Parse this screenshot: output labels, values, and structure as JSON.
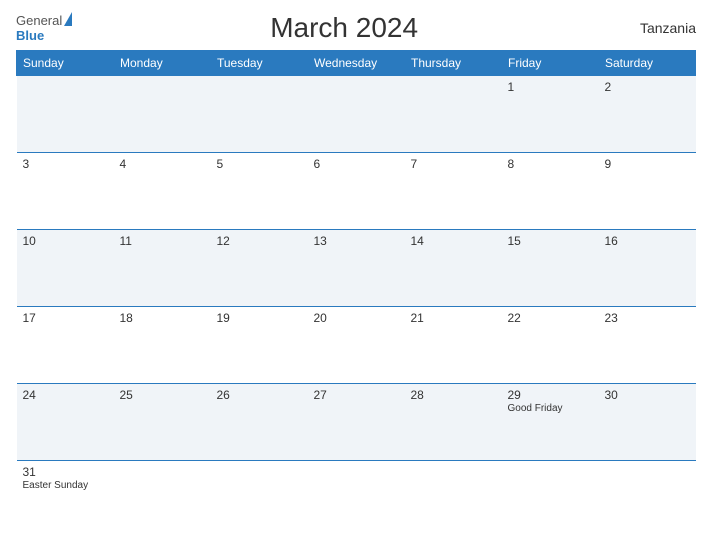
{
  "header": {
    "title": "March 2024",
    "country": "Tanzania",
    "logo_general": "General",
    "logo_blue": "Blue"
  },
  "weekdays": [
    "Sunday",
    "Monday",
    "Tuesday",
    "Wednesday",
    "Thursday",
    "Friday",
    "Saturday"
  ],
  "weeks": [
    [
      {
        "day": "",
        "event": ""
      },
      {
        "day": "",
        "event": ""
      },
      {
        "day": "",
        "event": ""
      },
      {
        "day": "",
        "event": ""
      },
      {
        "day": "",
        "event": ""
      },
      {
        "day": "1",
        "event": ""
      },
      {
        "day": "2",
        "event": ""
      }
    ],
    [
      {
        "day": "3",
        "event": ""
      },
      {
        "day": "4",
        "event": ""
      },
      {
        "day": "5",
        "event": ""
      },
      {
        "day": "6",
        "event": ""
      },
      {
        "day": "7",
        "event": ""
      },
      {
        "day": "8",
        "event": ""
      },
      {
        "day": "9",
        "event": ""
      }
    ],
    [
      {
        "day": "10",
        "event": ""
      },
      {
        "day": "11",
        "event": ""
      },
      {
        "day": "12",
        "event": ""
      },
      {
        "day": "13",
        "event": ""
      },
      {
        "day": "14",
        "event": ""
      },
      {
        "day": "15",
        "event": ""
      },
      {
        "day": "16",
        "event": ""
      }
    ],
    [
      {
        "day": "17",
        "event": ""
      },
      {
        "day": "18",
        "event": ""
      },
      {
        "day": "19",
        "event": ""
      },
      {
        "day": "20",
        "event": ""
      },
      {
        "day": "21",
        "event": ""
      },
      {
        "day": "22",
        "event": ""
      },
      {
        "day": "23",
        "event": ""
      }
    ],
    [
      {
        "day": "24",
        "event": ""
      },
      {
        "day": "25",
        "event": ""
      },
      {
        "day": "26",
        "event": ""
      },
      {
        "day": "27",
        "event": ""
      },
      {
        "day": "28",
        "event": ""
      },
      {
        "day": "29",
        "event": "Good Friday"
      },
      {
        "day": "30",
        "event": ""
      }
    ],
    [
      {
        "day": "31",
        "event": "Easter Sunday"
      },
      {
        "day": "",
        "event": ""
      },
      {
        "day": "",
        "event": ""
      },
      {
        "day": "",
        "event": ""
      },
      {
        "day": "",
        "event": ""
      },
      {
        "day": "",
        "event": ""
      },
      {
        "day": "",
        "event": ""
      }
    ]
  ]
}
